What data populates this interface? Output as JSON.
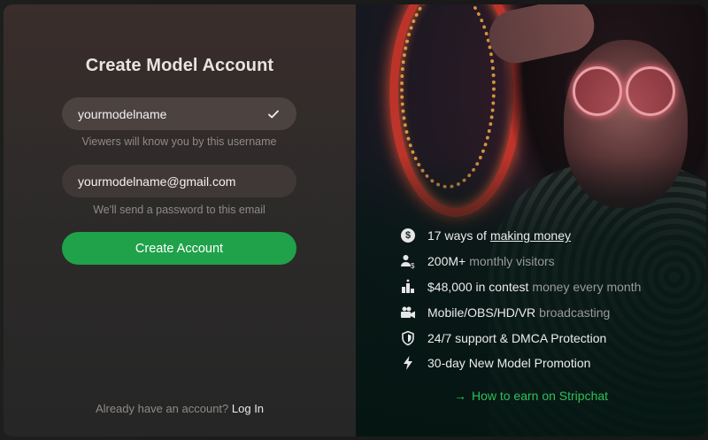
{
  "form": {
    "title": "Create Model Account",
    "username_value": "yourmodelname",
    "username_hint": "Viewers will know you by this username",
    "email_value": "yourmodelname@gmail.com",
    "email_hint": "We'll send a password to this email",
    "submit_label": "Create Account",
    "login_prompt": "Already have an account?",
    "login_link": "Log In"
  },
  "promo": {
    "features": [
      {
        "icon": "dollar-circle-icon",
        "text": "17 ways of",
        "link": "making money"
      },
      {
        "icon": "users-dollar-icon",
        "text": "200M+",
        "muted": "monthly visitors"
      },
      {
        "icon": "trophy-icon",
        "text": "$48,000 in contest",
        "muted": "money every month"
      },
      {
        "icon": "camera-icon",
        "text": "Mobile/OBS/HD/VR",
        "muted": "broadcasting"
      },
      {
        "icon": "shield-icon",
        "text": "24/7 support & DMCA Protection"
      },
      {
        "icon": "lightning-icon",
        "text": "30-day New Model Promotion"
      }
    ],
    "earn_link": "How to earn on Stripchat"
  },
  "colors": {
    "accent_green": "#1fa24a",
    "link_green": "#2fbf58"
  }
}
